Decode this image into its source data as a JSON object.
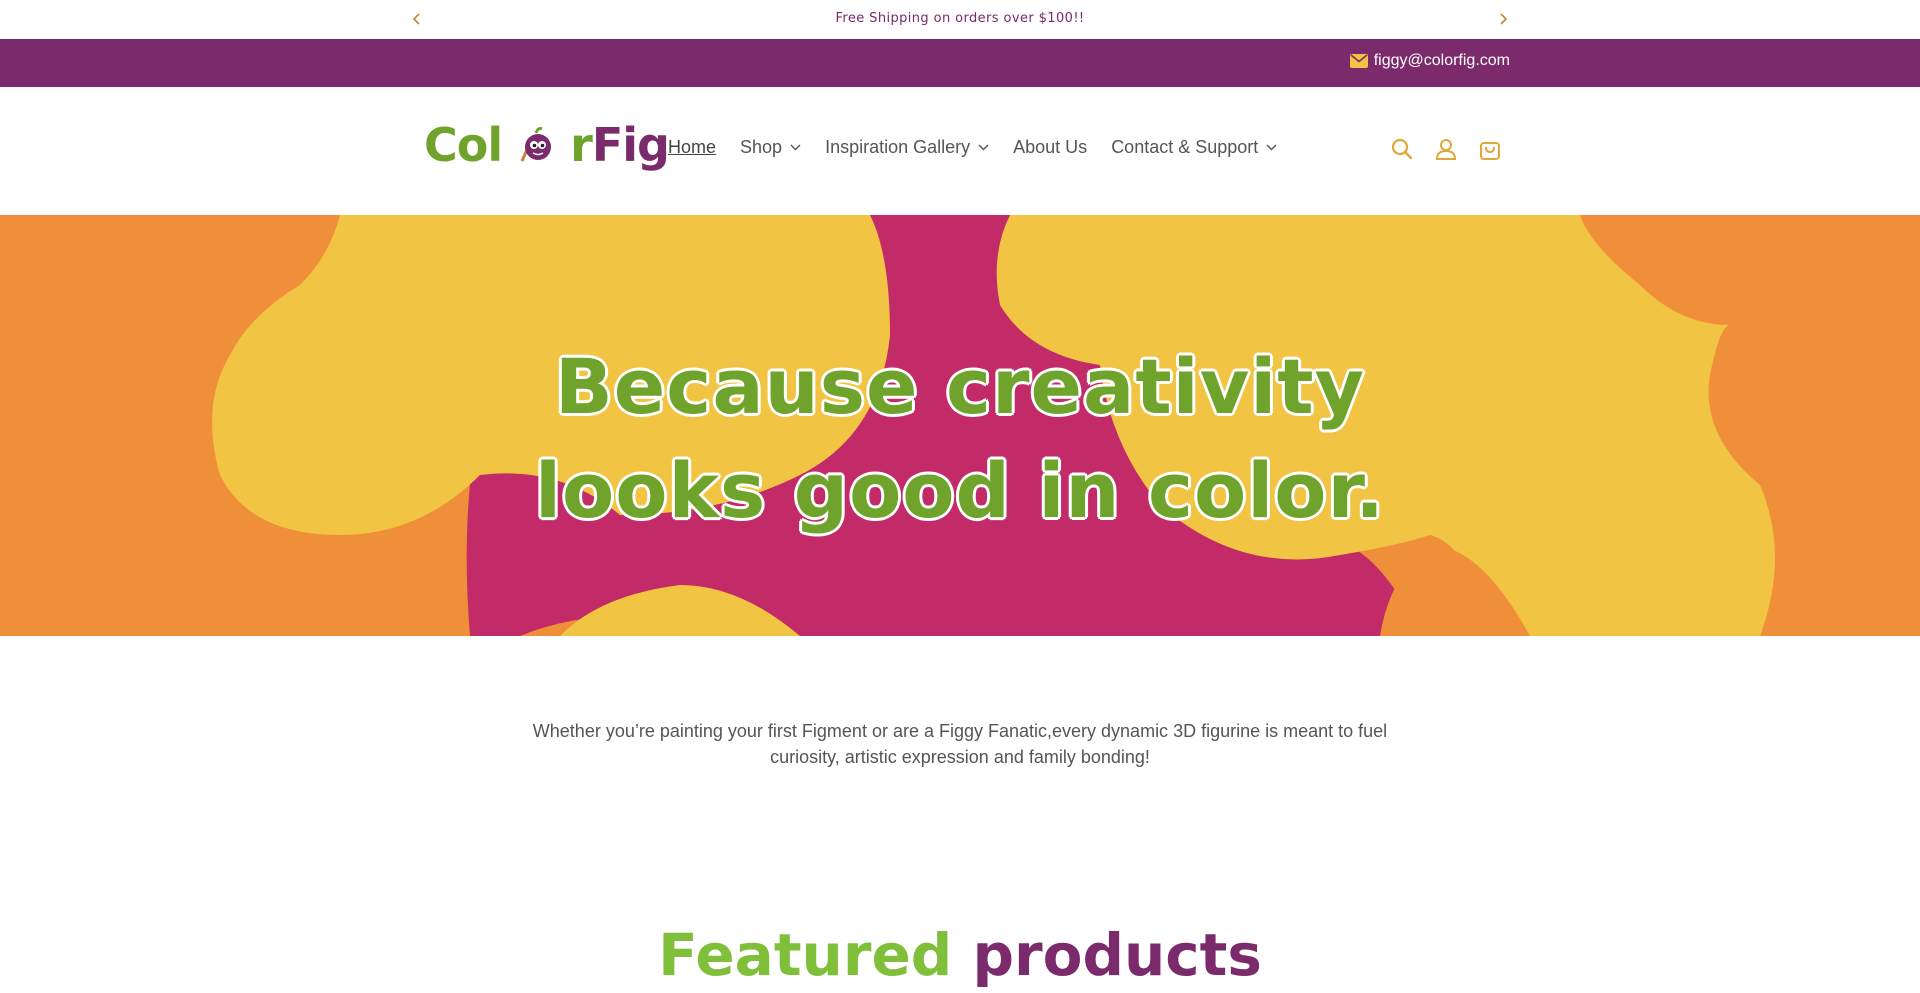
{
  "announcement": {
    "message": "Free Shipping on orders over $100!!",
    "prev_icon": "chevron-left-icon",
    "next_icon": "chevron-right-icon"
  },
  "topbar": {
    "email": "figgy@colorfig.com",
    "email_icon": "envelope-icon"
  },
  "header": {
    "logo": {
      "part1": "Col",
      "part2": "r",
      "part3": "Fig"
    },
    "nav": [
      {
        "label": "Home",
        "dropdown": false,
        "active": true
      },
      {
        "label": "Shop",
        "dropdown": true,
        "active": false
      },
      {
        "label": "Inspiration Gallery",
        "dropdown": true,
        "active": false
      },
      {
        "label": "About Us",
        "dropdown": false,
        "active": false
      },
      {
        "label": "Contact & Support",
        "dropdown": true,
        "active": false
      }
    ],
    "icons": [
      "search-icon",
      "account-icon",
      "cart-icon"
    ]
  },
  "hero": {
    "line1": "Because creativity",
    "line2": "looks good in color."
  },
  "intro": {
    "line1": "Whether you’re painting your first Figment or are a Figgy Fanatic,every dynamic 3D figurine is meant to fuel",
    "line2": "curiosity, artistic expression and family bonding!"
  },
  "featured": {
    "word1": "Featured",
    "word2": "products"
  },
  "colors": {
    "brand_purple": "#7b2a6b",
    "brand_green": "#6fa32c",
    "accent_orange": "#ef8f3a",
    "accent_yellow": "#f2c443",
    "accent_magenta": "#c22a68"
  }
}
